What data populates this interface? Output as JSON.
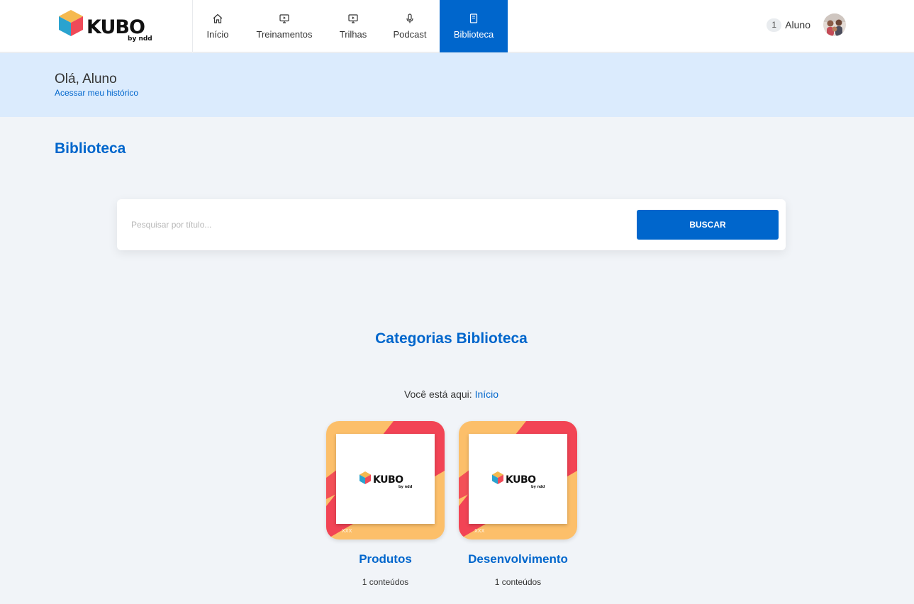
{
  "brand": {
    "name": "KUBO",
    "tagline": "by ndd"
  },
  "nav": {
    "items": [
      {
        "label": "Início",
        "icon": "home-icon",
        "active": false
      },
      {
        "label": "Treinamentos",
        "icon": "monitor-play-icon",
        "active": false
      },
      {
        "label": "Trilhas",
        "icon": "monitor-play-icon",
        "active": false
      },
      {
        "label": "Podcast",
        "icon": "microphone-icon",
        "active": false
      },
      {
        "label": "Biblioteca",
        "icon": "book-icon",
        "active": true
      }
    ]
  },
  "user": {
    "notification_count": "1",
    "name": "Aluno",
    "avatar": "avatar-icon"
  },
  "banner": {
    "greeting": "Olá, Aluno",
    "history_link": "Acessar meu histórico"
  },
  "page": {
    "title": "Biblioteca"
  },
  "search": {
    "placeholder": "Pesquisar por título...",
    "value": "",
    "button_label": "BUSCAR"
  },
  "categories": {
    "title": "Categorias Biblioteca",
    "breadcrumb_prefix": "Você está aqui:",
    "breadcrumb_link": "Início",
    "items": [
      {
        "title": "Produtos",
        "count": "1 conteúdos",
        "image": "kubo-logo-thumbnail",
        "thumb_mark": "XXX"
      },
      {
        "title": "Desenvolvimento",
        "count": "1 conteúdos",
        "image": "kubo-logo-thumbnail",
        "thumb_mark": "XXX"
      }
    ]
  },
  "colors": {
    "primary": "#0066cc",
    "banner_bg": "#dbebfd",
    "page_bg": "#f1f4f8",
    "thumb_red": "#f24455",
    "thumb_yellow": "#fcbf6a",
    "cube_yellow": "#f5b94f",
    "cube_blue": "#2aa3cf",
    "cube_red": "#ef4a58"
  }
}
